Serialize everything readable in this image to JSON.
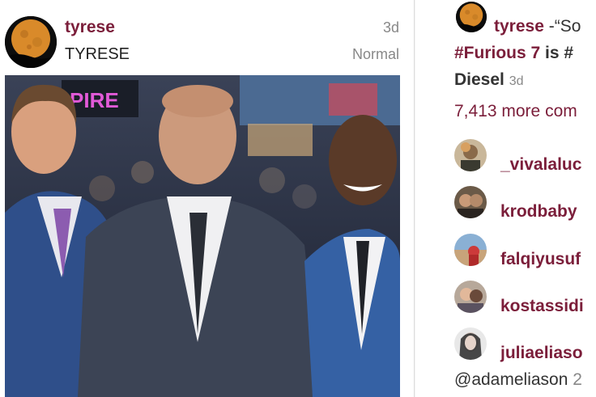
{
  "post": {
    "username": "tyrese",
    "fullname": "TYRESE",
    "age": "3d",
    "filter": "Normal",
    "photo_sign_text": "PIRE"
  },
  "caption": {
    "username": "tyrese",
    "text_start": " -“So",
    "tags_line": "#Furious 7",
    "tags_line_rest": " is #",
    "line3": "Diesel",
    "line3_age": "3d"
  },
  "more_comments": "7,413 more com",
  "comments": [
    {
      "username": "_vivalaluc"
    },
    {
      "username": "krodbaby"
    },
    {
      "username": "falqiyusuf"
    },
    {
      "username": "kostassidi"
    },
    {
      "username": "juliaeliaso"
    }
  ],
  "reply": {
    "text": "@adameliason",
    "age": " 2"
  },
  "colors": {
    "accent": "#7b1e3a",
    "muted": "#888888",
    "text": "#222222"
  },
  "icons": {
    "avatar": "full-moon-avatar-icon"
  }
}
